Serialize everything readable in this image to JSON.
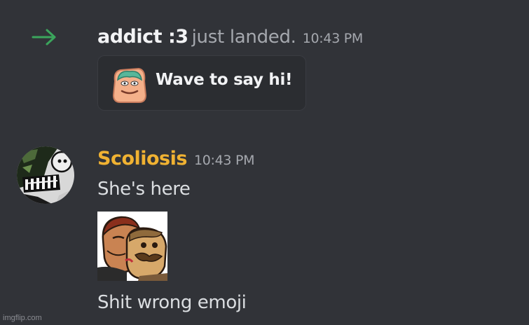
{
  "join_event": {
    "icon": "arrow-right-icon",
    "icon_color": "#3ba55c",
    "username": "addict :3",
    "message": "just landed.",
    "timestamp": "10:43 PM",
    "wave_button": {
      "sticker_icon": "wave-sticker-icon",
      "label": "Wave to say hi!"
    }
  },
  "message": {
    "author": "Scoliosis",
    "author_color": "#f0b232",
    "avatar": "avatar-image",
    "timestamp": "10:43 PM",
    "lines": [
      "She's here",
      "Shit wrong emoji"
    ],
    "attachment": "emoji-image"
  },
  "watermark": "imgflip.com",
  "colors": {
    "background": "#313338",
    "text": "#dbdee1",
    "muted": "#a5a8ae",
    "button_bg": "#2b2d31"
  }
}
